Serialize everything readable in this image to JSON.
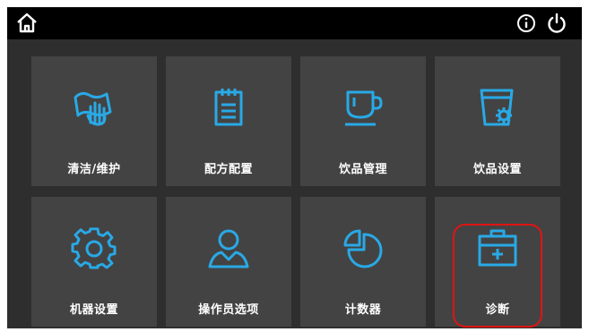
{
  "topbar": {
    "home_icon": "home-icon",
    "info_icon": "info-icon",
    "power_icon": "power-icon",
    "icon_color": "#ffffff"
  },
  "accent_color": "#29a9e6",
  "tiles": [
    {
      "label": "清洁/维护",
      "icon": "cleaning-hand-icon"
    },
    {
      "label": "配方配置",
      "icon": "recipe-clipboard-icon"
    },
    {
      "label": "饮品管理",
      "icon": "cup-icon"
    },
    {
      "label": "饮品设置",
      "icon": "cup-gear-icon"
    },
    {
      "label": "机器设置",
      "icon": "gear-icon"
    },
    {
      "label": "操作员选项",
      "icon": "user-icon"
    },
    {
      "label": "计数器",
      "icon": "pie-chart-icon"
    },
    {
      "label": "诊断",
      "icon": "first-aid-kit-icon"
    }
  ],
  "highlight_color": "#e01414"
}
